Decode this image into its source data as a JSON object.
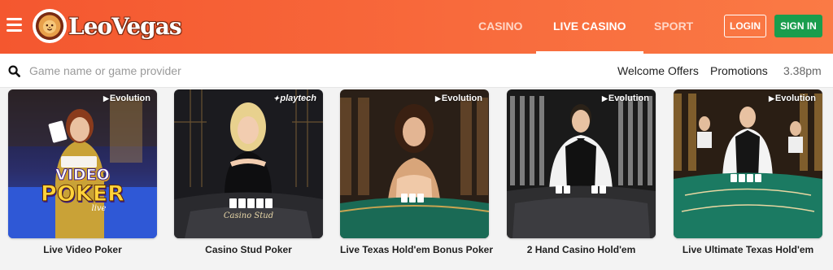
{
  "header": {
    "brand": "LeoVegas",
    "nav": [
      {
        "label": "CASINO"
      },
      {
        "label": "LIVE CASINO",
        "active": true
      },
      {
        "label": "SPORT"
      }
    ],
    "login_label": "LOGIN",
    "signin_label": "SIGN IN"
  },
  "search": {
    "placeholder": "Game name or game provider",
    "value": ""
  },
  "links": {
    "welcome": "Welcome Offers",
    "promotions": "Promotions"
  },
  "clock": "3.38pm",
  "games": [
    {
      "title": "Live Video Poker",
      "provider": "Evolution",
      "thumb_text": [
        "VIDEO",
        "POKER",
        "live"
      ]
    },
    {
      "title": "Casino Stud Poker",
      "provider": "playtech",
      "thumb_text": [
        "Casino Stud"
      ]
    },
    {
      "title": "Live Texas Hold'em Bonus Poker",
      "provider": "Evolution"
    },
    {
      "title": "2 Hand Casino Hold'em",
      "provider": "Evolution"
    },
    {
      "title": "Live Ultimate Texas Hold'em",
      "provider": "Evolution"
    }
  ],
  "colors": {
    "header_orange": "#f4572f",
    "signin_green": "#1a9d4d",
    "poker_table_green": "#1b7a62",
    "video_poker_blue": "#2a4fc7"
  },
  "icons": [
    "menu-icon",
    "lion-logo-icon",
    "search-icon",
    "evolution-logo-icon",
    "playtech-logo-icon"
  ]
}
